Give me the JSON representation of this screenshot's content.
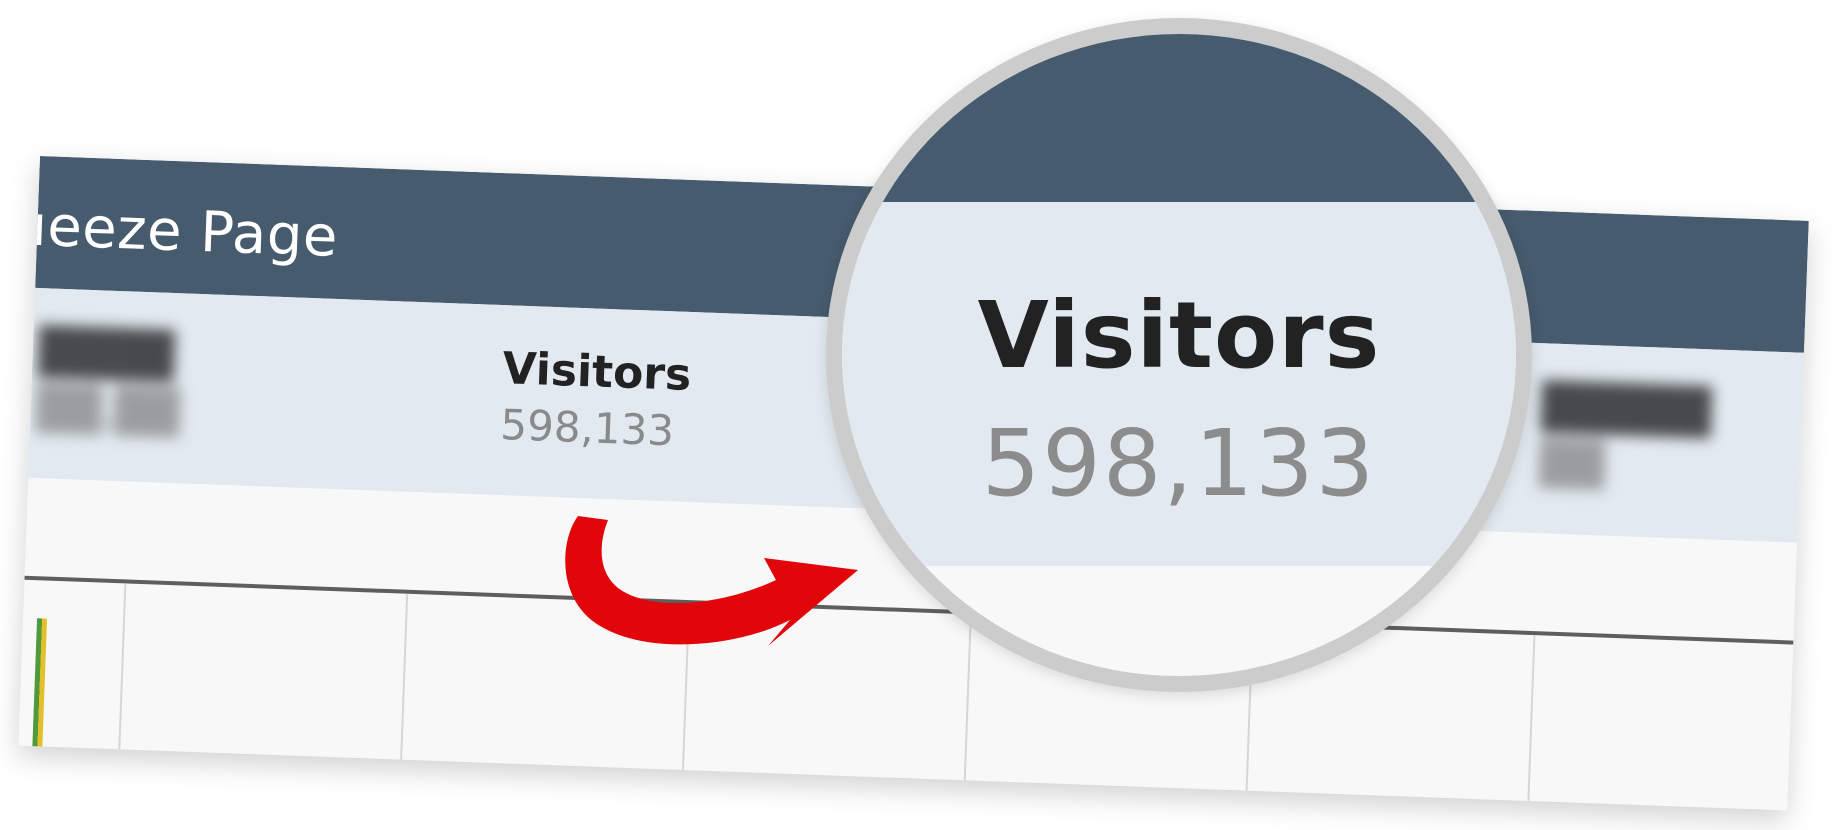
{
  "panel": {
    "title": "ueeze Page"
  },
  "stats": {
    "visitors_label": "Visitors",
    "visitors_value": "598,133"
  },
  "magnifier": {
    "label": "Visitors",
    "value": "598,133"
  },
  "colors": {
    "header": "#475b6e",
    "stats_bg": "#e2e9f0",
    "arrow": "#e0060a",
    "magnifier_ring": "#cccccc",
    "bar_green": "#4f9a3c",
    "bar_yellow": "#e3c02a"
  }
}
